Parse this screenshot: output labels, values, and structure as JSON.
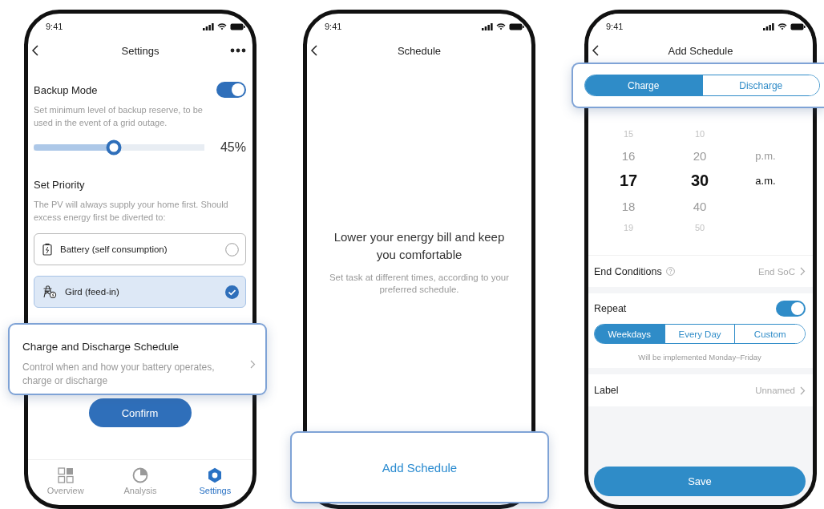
{
  "settings_screen": {
    "status_time": "9:41",
    "title": "Settings",
    "backup_mode": {
      "label": "Backup Mode",
      "on": true,
      "description": "Set minimum level of backup reserve, to be used in the event of a grid outage.",
      "level": 0.47,
      "reading": "45%"
    },
    "priority": {
      "title": "Set Priority",
      "description": "The PV will always supply your home first. Should excess energy first be diverted to:",
      "options": [
        {
          "kind": "battery",
          "label": "Battery (self consumption)",
          "selected": false
        },
        {
          "kind": "grid",
          "label": "Gird (feed-in)",
          "selected": true
        }
      ]
    },
    "callout": {
      "title": "Charge and Discharge Schedule",
      "description": "Control when and how your battery operates, charge or discharge"
    },
    "confirm_button": "Confirm",
    "nav": [
      {
        "kind": "overview",
        "label": "Overview",
        "selected": false
      },
      {
        "kind": "analysis",
        "label": "Analysis",
        "selected": false
      },
      {
        "kind": "settings",
        "label": "Settings",
        "selected": true
      }
    ]
  },
  "schedule_screen": {
    "status_time": "9:41",
    "title": "Schedule",
    "empty_title": "Lower your energy bill and keep you comfortable",
    "empty_description": "Set task at different times, according to your preferred schedule.",
    "add_button": "Add Schedule"
  },
  "add_schedule_screen": {
    "status_time": "9:41",
    "title": "Add Schedule",
    "mode_tabs": [
      {
        "label": "Charge",
        "selected": true
      },
      {
        "label": "Discharge",
        "selected": false
      }
    ],
    "picker": [
      {
        "items": [
          {
            "label": "15",
            "selected": false
          },
          {
            "label": "16",
            "selected": false
          },
          {
            "label": "17",
            "selected": true
          },
          {
            "label": "18",
            "selected": false
          },
          {
            "label": "19",
            "selected": false
          }
        ]
      },
      {
        "items": [
          {
            "label": "10",
            "selected": false
          },
          {
            "label": "20",
            "selected": false
          },
          {
            "label": "30",
            "selected": true
          },
          {
            "label": "40",
            "selected": false
          },
          {
            "label": "50",
            "selected": false
          }
        ]
      },
      {
        "items": [
          {
            "label": "p.m.",
            "selected": false
          },
          {
            "label": "a.m.",
            "selected": true
          }
        ]
      }
    ],
    "end_conditions": {
      "label": "End Conditions",
      "value": "End SoC"
    },
    "repeat": {
      "label": "Repeat",
      "on": true,
      "options": [
        {
          "label": "Weekdays",
          "selected": true
        },
        {
          "label": "Every Day",
          "selected": false
        },
        {
          "label": "Custom",
          "selected": false
        }
      ],
      "note": "Will be implemented Monday–Friday"
    },
    "label_row": {
      "label": "Label",
      "value": "Unnamed"
    },
    "save_button": "Save"
  }
}
